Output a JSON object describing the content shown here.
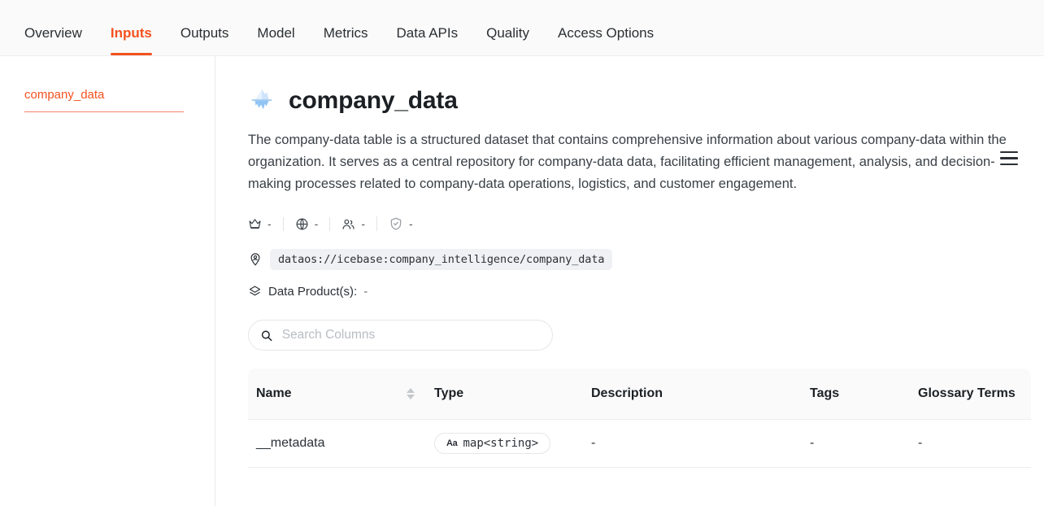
{
  "theme": {
    "accent": "#f4511e",
    "text": "#1c2024",
    "muted": "#6b7178",
    "header_bg": "#fafafa"
  },
  "topbar": {
    "tabs": [
      {
        "label": "Overview",
        "active": false
      },
      {
        "label": "Inputs",
        "active": true
      },
      {
        "label": "Outputs",
        "active": false
      },
      {
        "label": "Model",
        "active": false
      },
      {
        "label": "Metrics",
        "active": false
      },
      {
        "label": "Data APIs",
        "active": false
      },
      {
        "label": "Quality",
        "active": false
      },
      {
        "label": "Access Options",
        "active": false
      }
    ]
  },
  "sidebar": {
    "items": [
      {
        "label": "company_data",
        "selected": true
      }
    ]
  },
  "main": {
    "icon": "iceberg-icon",
    "title": "company_data",
    "menu_icon": "hamburger-menu-icon",
    "description": "The company-data table is a structured dataset that contains comprehensive information about various company-data within the organization. It serves as a central repository for company-data data, facilitating efficient management, analysis, and decision-making processes related to company-data operations, logistics, and customer engagement.",
    "meta_strip": [
      {
        "icon": "crown-icon",
        "value": "-"
      },
      {
        "icon": "globe-icon",
        "value": "-"
      },
      {
        "icon": "users-icon",
        "value": "-"
      },
      {
        "icon": "shield-check-icon",
        "value": "-"
      }
    ],
    "address": {
      "icon": "address-pin-icon",
      "value": "dataos://icebase:company_intelligence/company_data"
    },
    "data_products": {
      "icon": "layers-icon",
      "label": "Data Product(s):",
      "value": "-"
    },
    "search": {
      "icon": "search-icon",
      "placeholder": "Search Columns",
      "value": ""
    },
    "table": {
      "columns": [
        {
          "label": "Name",
          "sortable": true
        },
        {
          "label": "Type",
          "sortable": false
        },
        {
          "label": "Description",
          "sortable": false
        },
        {
          "label": "Tags",
          "sortable": false
        },
        {
          "label": "Glossary Terms",
          "sortable": false
        }
      ],
      "rows": [
        {
          "name": "__metadata",
          "type_icon": "Aa",
          "type": "map<string>",
          "description": "-",
          "tags": "-",
          "glossary_terms": "-"
        }
      ]
    }
  }
}
